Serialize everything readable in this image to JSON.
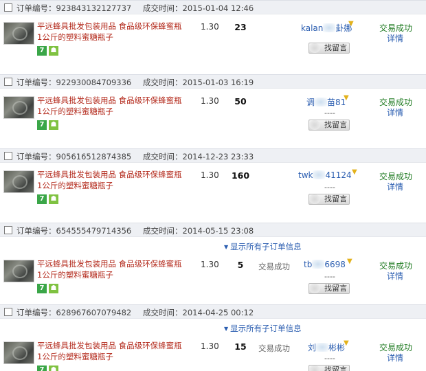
{
  "labels": {
    "order_no_prefix": "订单编号：",
    "deal_time_prefix": "成交时间：",
    "show_sub_orders": "显示所有子订单信息",
    "leave_message": "找留言",
    "detail": "详情",
    "dashes": "----"
  },
  "orders": [
    {
      "order_no": "923843132127737",
      "deal_time": "2015-01-04 12:46",
      "title": "平远蜂具批发包装用品 食品级环保蜂蜜瓶1公斤的塑料蜜糖瓶子",
      "price": "1.30",
      "qty": "23",
      "sub_status": "",
      "buyer_a": "kalan",
      "buyer_b": "卦娜",
      "status": "交易成功"
    },
    {
      "order_no": "922930084709336",
      "deal_time": "2015-01-03 16:19",
      "title": "平远蜂具批发包装用品 食品级环保蜂蜜瓶1公斤的塑料蜜糖瓶子",
      "price": "1.30",
      "qty": "50",
      "sub_status": "",
      "buyer_a": "调",
      "buyer_b": "苗81",
      "status": "交易成功"
    },
    {
      "order_no": "905616512874385",
      "deal_time": "2014-12-23 23:33",
      "title": "平远蜂具批发包装用品 食品级环保蜂蜜瓶1公斤的塑料蜜糖瓶子",
      "price": "1.30",
      "qty": "160",
      "sub_status": "",
      "buyer_a": "twk",
      "buyer_b": "41124",
      "status": "交易成功"
    },
    {
      "order_no": "654555479714356",
      "deal_time": "2014-05-15 23:08",
      "title": "平远蜂具批发包装用品 食品级环保蜂蜜瓶1公斤的塑料蜜糖瓶子",
      "price": "1.30",
      "qty": "5",
      "sub_status": "交易成功",
      "buyer_a": "tb",
      "buyer_b": "6698",
      "status": "交易成功"
    },
    {
      "order_no": "628967607079482",
      "deal_time": "2014-04-25 00:12",
      "title": "平远蜂具批发包装用品 食品级环保蜂蜜瓶1公斤的塑料蜜糖瓶子",
      "price": "1.30",
      "qty": "15",
      "sub_status": "交易成功",
      "buyer_a": "刘",
      "buyer_b": "彬彬",
      "status": "交易成功"
    }
  ]
}
